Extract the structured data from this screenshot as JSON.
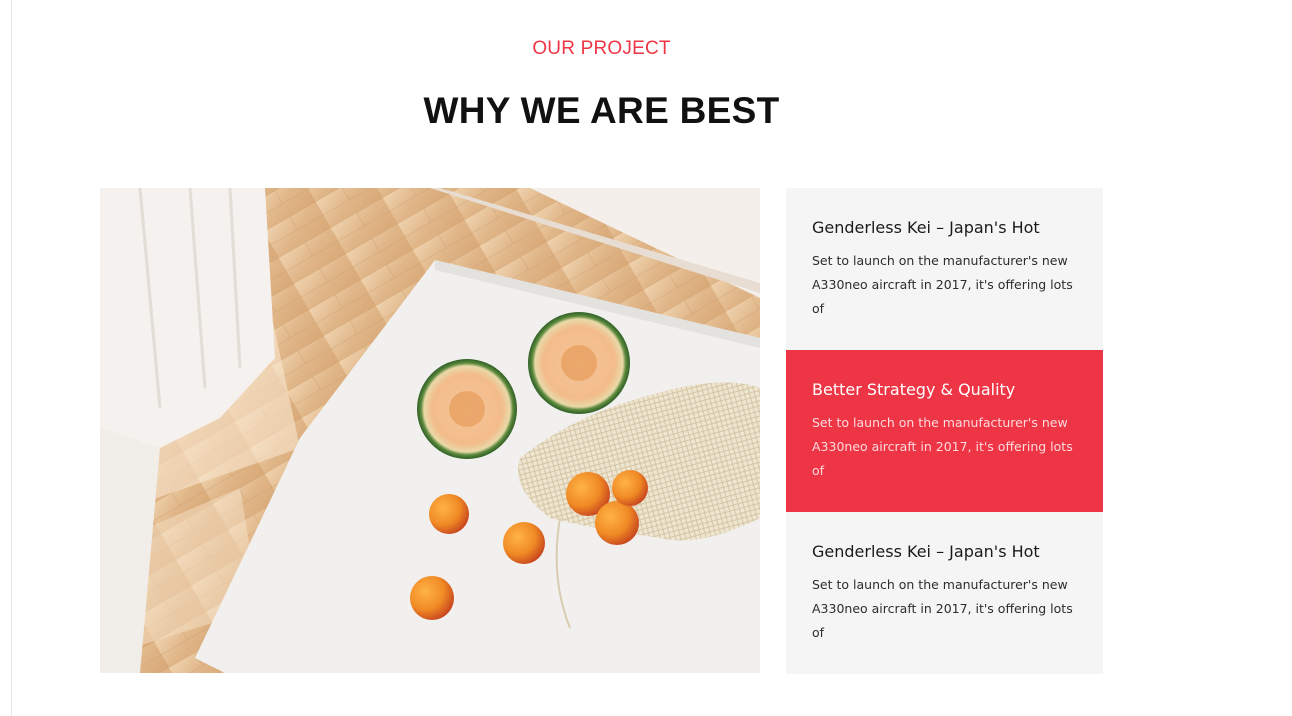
{
  "section": {
    "eyebrow": "OUR PROJECT",
    "title": "WHY WE ARE BEST"
  },
  "image": {
    "description_icon": "fruit-photo"
  },
  "cards": [
    {
      "title": "Genderless Kei – Japan's Hot",
      "text": "Set to launch on the manufacturer's new A330neo aircraft in 2017, it's offering lots of",
      "active": false
    },
    {
      "title": "Better Strategy & Quality",
      "text": "Set to launch on the manufacturer's new A330neo aircraft in 2017, it's offering lots of",
      "active": true
    },
    {
      "title": "Genderless Kei – Japan's Hot",
      "text": "Set to launch on the manufacturer's new A330neo aircraft in 2017, it's offering lots of",
      "active": false
    }
  ],
  "colors": {
    "accent": "#ee3545",
    "card_bg": "#f5f5f5",
    "heading": "#111111"
  }
}
